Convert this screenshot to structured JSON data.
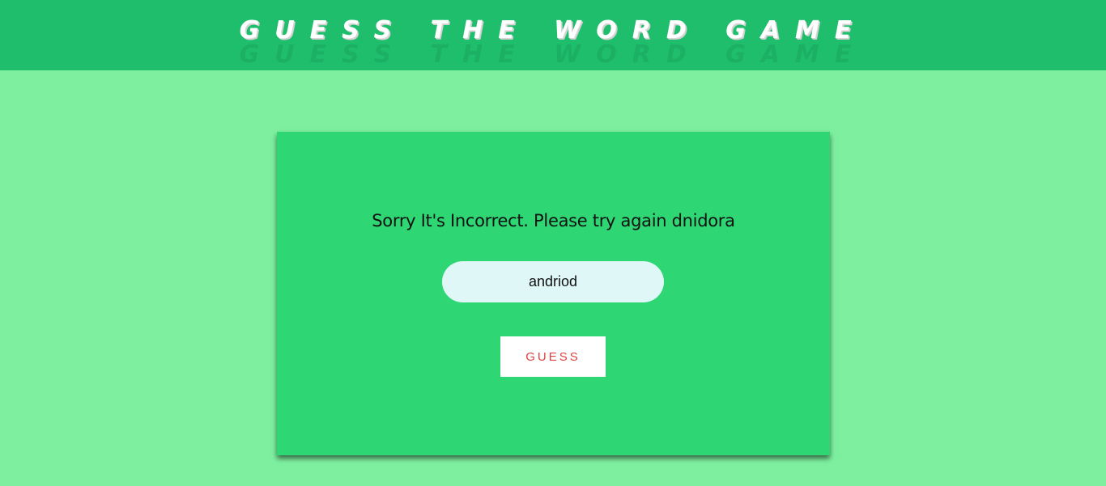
{
  "header": {
    "title": "GUESS THE WORD GAME"
  },
  "game": {
    "message": "Sorry It's Incorrect. Please try again dnidora",
    "input_value": "andriod",
    "button_label": "GUESS"
  },
  "colors": {
    "page_background": "#7def9f",
    "header_background": "#1fbe6c",
    "card_background": "#2ed674",
    "input_background": "#dff7f7",
    "button_text": "#e04343"
  }
}
